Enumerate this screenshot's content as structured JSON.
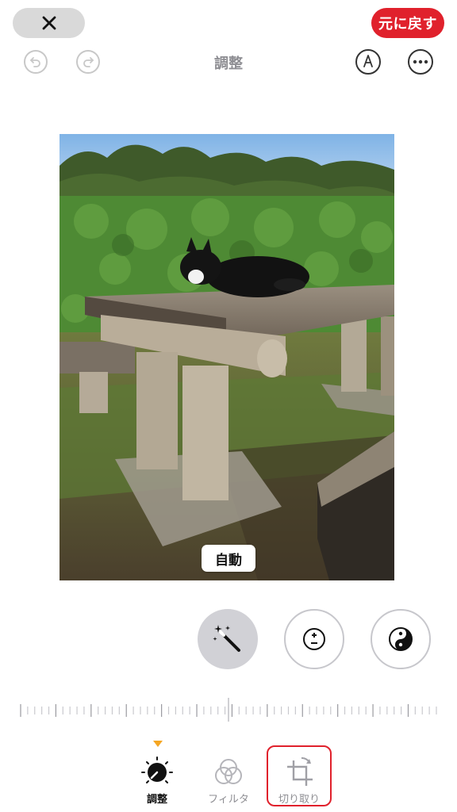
{
  "header": {
    "title": "調整",
    "revert_label": "元に戻す",
    "cancel_icon": "close-icon",
    "undo_icon": "undo-icon",
    "redo_icon": "redo-icon",
    "markup_icon": "markup-pen-icon",
    "more_icon": "more-ellipsis-icon"
  },
  "photo": {
    "auto_label": "自動"
  },
  "adjust_tools": [
    {
      "name": "auto-enhance",
      "icon": "magic-wand-icon",
      "active": true
    },
    {
      "name": "exposure",
      "icon": "exposure-icon",
      "active": false
    },
    {
      "name": "brilliance",
      "icon": "brilliance-icon",
      "active": false
    }
  ],
  "tabs": [
    {
      "label": "調整",
      "icon": "adjust-dial-icon",
      "selected": true
    },
    {
      "label": "フィルタ",
      "icon": "filter-circles-icon",
      "selected": false
    },
    {
      "label": "切り取り",
      "icon": "crop-rotate-icon",
      "selected": false
    }
  ],
  "colors": {
    "accent_red": "#e0212c",
    "selected_indicator": "#f5a623",
    "inactive_text": "#8e8e93"
  }
}
